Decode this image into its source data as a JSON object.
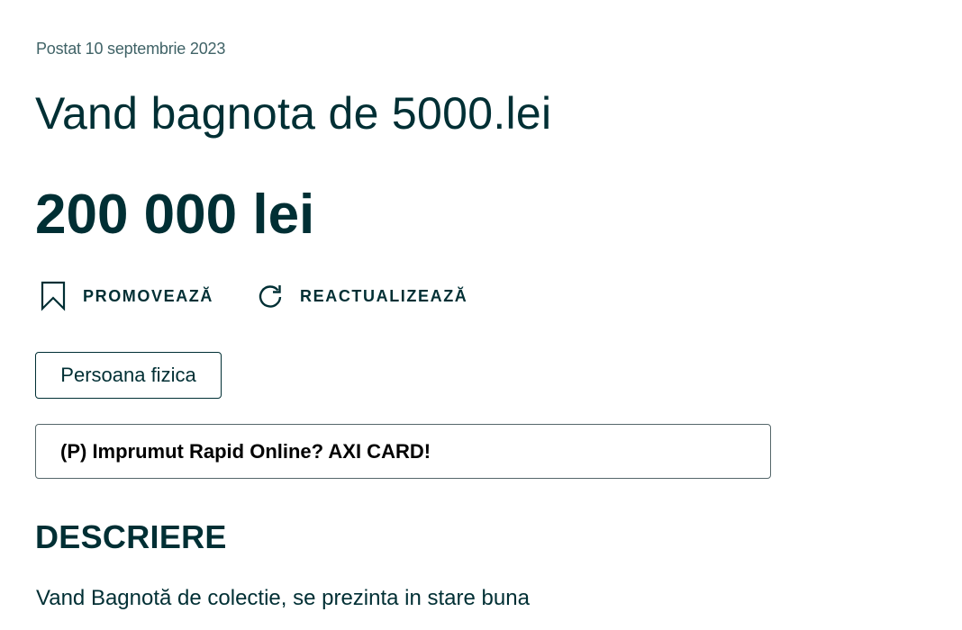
{
  "listing": {
    "posted": "Postat 10 septembrie 2023",
    "title": "Vand bagnota de 5000.lei",
    "price": "200 000 lei",
    "seller_type": "Persoana fizica"
  },
  "actions": {
    "promote_label": "PROMOVEAZĂ",
    "promote_icon": "bookmark-icon",
    "refresh_label": "REACTUALIZEAZĂ",
    "refresh_icon": "refresh-icon"
  },
  "ad": {
    "text": "(P) Imprumut Rapid Online? AXI CARD!"
  },
  "description": {
    "heading": "DESCRIERE",
    "body": "Vand Bagnotă de colectie, se prezinta in stare buna"
  },
  "colors": {
    "text_primary": "#002f34",
    "text_secondary": "#406367",
    "icon": "#002f34"
  }
}
